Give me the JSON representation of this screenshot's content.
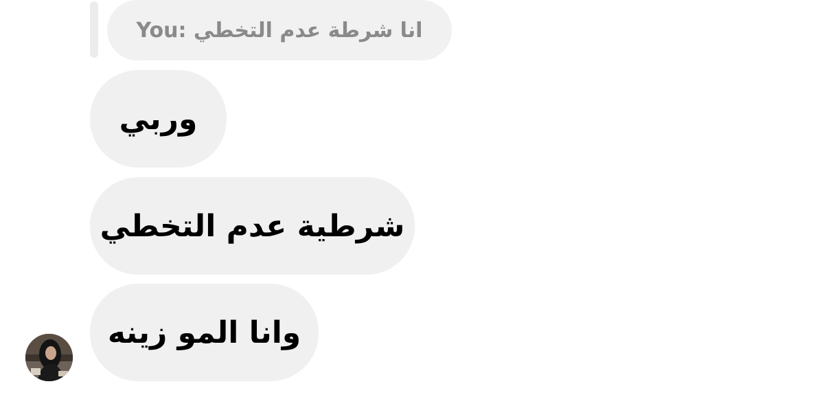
{
  "reply": {
    "text": "You: انا شرطة عدم التخطي"
  },
  "messages": [
    {
      "text": "وربي"
    },
    {
      "text": "شرطية عدم التخطي"
    },
    {
      "text": "وانا المو زينه"
    }
  ],
  "avatar": {
    "icon": "profile-photo"
  }
}
